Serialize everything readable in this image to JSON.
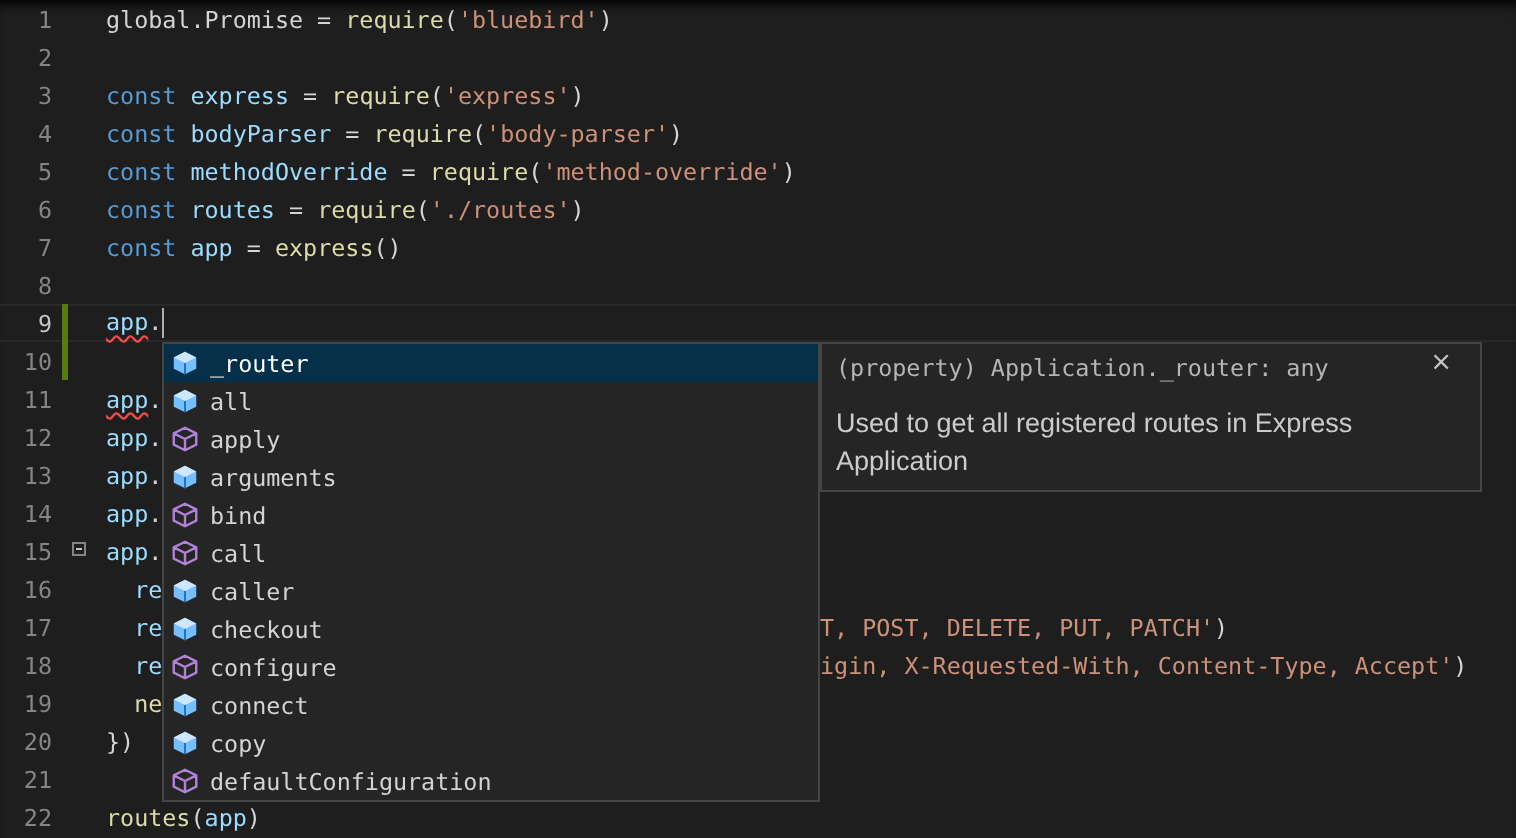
{
  "editor": {
    "lines": [
      {
        "number": "1",
        "current": false,
        "modified": false,
        "tokens": [
          {
            "text": "global.Promise = ",
            "kind": "plain"
          },
          {
            "text": "require",
            "kind": "function"
          },
          {
            "text": "(",
            "kind": "plain"
          },
          {
            "text": "'bluebird'",
            "kind": "string"
          },
          {
            "text": ")",
            "kind": "plain"
          }
        ]
      },
      {
        "number": "2",
        "current": false,
        "modified": false
      },
      {
        "number": "3",
        "current": false,
        "modified": false,
        "tokens": [
          {
            "text": "const ",
            "kind": "keyword"
          },
          {
            "text": "express",
            "kind": "variable"
          },
          {
            "text": " = ",
            "kind": "plain"
          },
          {
            "text": "require",
            "kind": "function"
          },
          {
            "text": "(",
            "kind": "plain"
          },
          {
            "text": "'express'",
            "kind": "string"
          },
          {
            "text": ")",
            "kind": "plain"
          }
        ]
      },
      {
        "number": "4",
        "current": false,
        "modified": false,
        "tokens": [
          {
            "text": "const ",
            "kind": "keyword"
          },
          {
            "text": "bodyParser",
            "kind": "variable"
          },
          {
            "text": " = ",
            "kind": "plain"
          },
          {
            "text": "require",
            "kind": "function"
          },
          {
            "text": "(",
            "kind": "plain"
          },
          {
            "text": "'body-parser'",
            "kind": "string"
          },
          {
            "text": ")",
            "kind": "plain"
          }
        ]
      },
      {
        "number": "5",
        "current": false,
        "modified": false,
        "tokens": [
          {
            "text": "const ",
            "kind": "keyword"
          },
          {
            "text": "methodOverride",
            "kind": "variable"
          },
          {
            "text": " = ",
            "kind": "plain"
          },
          {
            "text": "require",
            "kind": "function"
          },
          {
            "text": "(",
            "kind": "plain"
          },
          {
            "text": "'method-override'",
            "kind": "string"
          },
          {
            "text": ")",
            "kind": "plain"
          }
        ]
      },
      {
        "number": "6",
        "current": false,
        "modified": false,
        "tokens": [
          {
            "text": "const ",
            "kind": "keyword"
          },
          {
            "text": "routes",
            "kind": "variable"
          },
          {
            "text": " = ",
            "kind": "plain"
          },
          {
            "text": "require",
            "kind": "function"
          },
          {
            "text": "(",
            "kind": "plain"
          },
          {
            "text": "'./routes'",
            "kind": "string"
          },
          {
            "text": ")",
            "kind": "plain"
          }
        ]
      },
      {
        "number": "7",
        "current": false,
        "modified": false,
        "tokens": [
          {
            "text": "const ",
            "kind": "keyword"
          },
          {
            "text": "app",
            "kind": "variable"
          },
          {
            "text": " = ",
            "kind": "plain"
          },
          {
            "text": "express",
            "kind": "function"
          },
          {
            "text": "()",
            "kind": "plain"
          }
        ]
      },
      {
        "number": "8",
        "current": false,
        "modified": false
      },
      {
        "number": "9",
        "current": true,
        "modified": true,
        "tokens": [
          {
            "text": "app",
            "kind": "variable",
            "error": true
          },
          {
            "text": ".",
            "kind": "plain"
          }
        ]
      },
      {
        "number": "10",
        "current": false,
        "modified": true
      },
      {
        "number": "11",
        "current": false,
        "modified": false,
        "tokens": [
          {
            "text": "app",
            "kind": "variable",
            "error": true
          },
          {
            "text": ".",
            "kind": "plain"
          }
        ]
      },
      {
        "number": "12",
        "current": false,
        "modified": false,
        "tokens": [
          {
            "text": "app",
            "kind": "variable"
          },
          {
            "text": ".",
            "kind": "plain"
          }
        ]
      },
      {
        "number": "13",
        "current": false,
        "modified": false,
        "tokens": [
          {
            "text": "app",
            "kind": "variable"
          },
          {
            "text": ".",
            "kind": "plain"
          }
        ]
      },
      {
        "number": "14",
        "current": false,
        "modified": false,
        "tokens": [
          {
            "text": "app",
            "kind": "variable"
          },
          {
            "text": ".",
            "kind": "plain"
          }
        ]
      },
      {
        "number": "15",
        "current": false,
        "modified": false,
        "foldable": true,
        "expanded": true,
        "tokens": [
          {
            "text": "app",
            "kind": "variable"
          },
          {
            "text": ".",
            "kind": "plain"
          }
        ]
      },
      {
        "number": "16",
        "current": false,
        "modified": false,
        "tokens": [
          {
            "text": "  re",
            "kind": "variable"
          }
        ]
      },
      {
        "number": "17",
        "current": false,
        "modified": false,
        "tokens": [
          {
            "text": "  re",
            "kind": "variable"
          }
        ],
        "tail": [
          {
            "text": "T, POST, DELETE, PUT, PATCH'",
            "kind": "string"
          },
          {
            "text": ")",
            "kind": "plain"
          }
        ]
      },
      {
        "number": "18",
        "current": false,
        "modified": false,
        "tokens": [
          {
            "text": "  re",
            "kind": "variable"
          }
        ],
        "tail": [
          {
            "text": "igin, X-Requested-With, Content-Type, Accept'",
            "kind": "string"
          },
          {
            "text": ")",
            "kind": "plain"
          }
        ]
      },
      {
        "number": "19",
        "current": false,
        "modified": false,
        "tokens": [
          {
            "text": "  ne",
            "kind": "function"
          }
        ]
      },
      {
        "number": "20",
        "current": false,
        "modified": false,
        "tokens": [
          {
            "text": "})",
            "kind": "plain"
          }
        ]
      },
      {
        "number": "21",
        "current": false,
        "modified": false
      },
      {
        "number": "22",
        "current": false,
        "modified": false,
        "tokens": [
          {
            "text": "routes",
            "kind": "function"
          },
          {
            "text": "(",
            "kind": "plain"
          },
          {
            "text": "app",
            "kind": "variable"
          },
          {
            "text": ")",
            "kind": "plain"
          }
        ]
      }
    ]
  },
  "suggestions": [
    {
      "label": "_router",
      "kind": "property",
      "selected": true
    },
    {
      "label": "all",
      "kind": "property",
      "selected": false
    },
    {
      "label": "apply",
      "kind": "method",
      "selected": false
    },
    {
      "label": "arguments",
      "kind": "property",
      "selected": false
    },
    {
      "label": "bind",
      "kind": "method",
      "selected": false
    },
    {
      "label": "call",
      "kind": "method",
      "selected": false
    },
    {
      "label": "caller",
      "kind": "property",
      "selected": false
    },
    {
      "label": "checkout",
      "kind": "property",
      "selected": false
    },
    {
      "label": "configure",
      "kind": "method",
      "selected": false
    },
    {
      "label": "connect",
      "kind": "property",
      "selected": false
    },
    {
      "label": "copy",
      "kind": "property",
      "selected": false
    },
    {
      "label": "defaultConfiguration",
      "kind": "method",
      "selected": false
    }
  ],
  "details": {
    "signature": "(property) Application._router: any",
    "description": "Used to get all registered routes in Express Application",
    "close": "×"
  }
}
